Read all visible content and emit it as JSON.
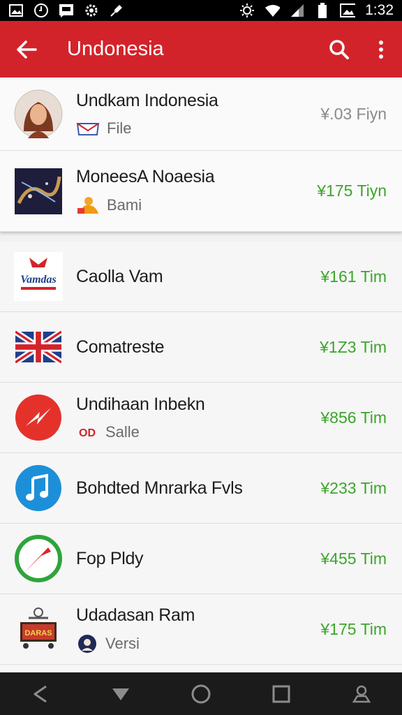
{
  "status_bar": {
    "time": "1:32"
  },
  "app_bar": {
    "title": "Undonesia"
  },
  "items": [
    {
      "title": "Undkam Indonesia",
      "sub": "File",
      "price": "¥.03 Fiyn"
    },
    {
      "title": "MoneesA Noaesia",
      "sub": "Bami",
      "price": "¥175 Tiyn"
    },
    {
      "title": "Caolla Vam",
      "sub": "",
      "price": "¥161 Tim"
    },
    {
      "title": "Comatreste",
      "sub": "",
      "price": "¥1Z3 Tim"
    },
    {
      "title": "Undihaan Inbekn",
      "sub": "Salle",
      "price": "¥856 Tim"
    },
    {
      "title": "Bohdted Mnrarka Fvls",
      "sub": "",
      "price": "¥233 Tim"
    },
    {
      "title": "Fop Pldy",
      "sub": "",
      "price": "¥455 Tim"
    },
    {
      "title": "Udadasan Ram",
      "sub": "Versi",
      "price": "¥175 Tim"
    }
  ],
  "logo_text": {
    "vamdas": "Vamdas",
    "bang": "DARAS"
  },
  "badge_text": "OD"
}
